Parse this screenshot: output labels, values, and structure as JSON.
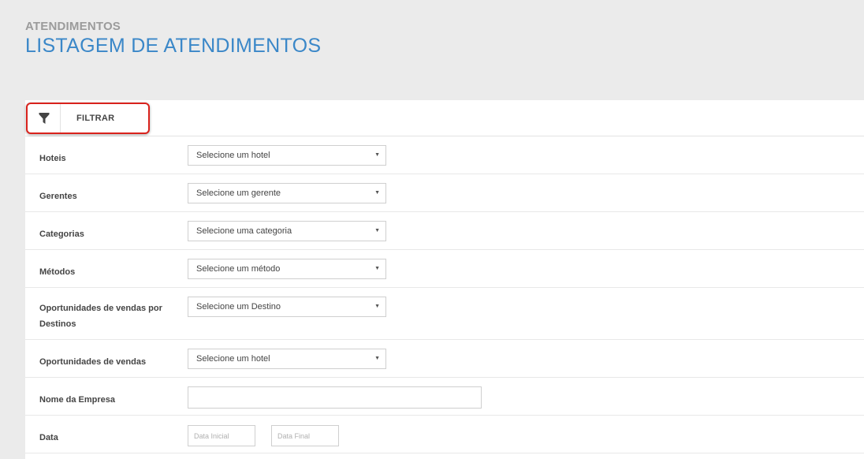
{
  "header": {
    "section": "ATENDIMENTOS",
    "title": "LISTAGEM DE ATENDIMENTOS"
  },
  "filter_bar": {
    "icon": "funnel-icon",
    "label": "FILTRAR"
  },
  "filters": {
    "hoteis": {
      "label": "Hoteis",
      "value": "Selecione um hotel"
    },
    "gerentes": {
      "label": "Gerentes",
      "value": "Selecione um gerente"
    },
    "categorias": {
      "label": "Categorias",
      "value": "Selecione uma categoria"
    },
    "metodos": {
      "label": "Métodos",
      "value": "Selecione um método"
    },
    "oportunidades_destinos": {
      "label": "Oportunidades de vendas por Destinos",
      "value": "Selecione um Destino"
    },
    "oportunidades": {
      "label": "Oportunidades de vendas",
      "value": "Selecione um hotel"
    },
    "empresa": {
      "label": "Nome da Empresa",
      "value": "",
      "placeholder": ""
    },
    "data": {
      "label": "Data",
      "start_placeholder": "Data Inicial",
      "end_placeholder": "Data Final"
    }
  },
  "dropdown_arrow": "▼",
  "colors": {
    "title": "#3a87c8",
    "highlight_border": "#d9221c",
    "background": "#ebebeb"
  }
}
